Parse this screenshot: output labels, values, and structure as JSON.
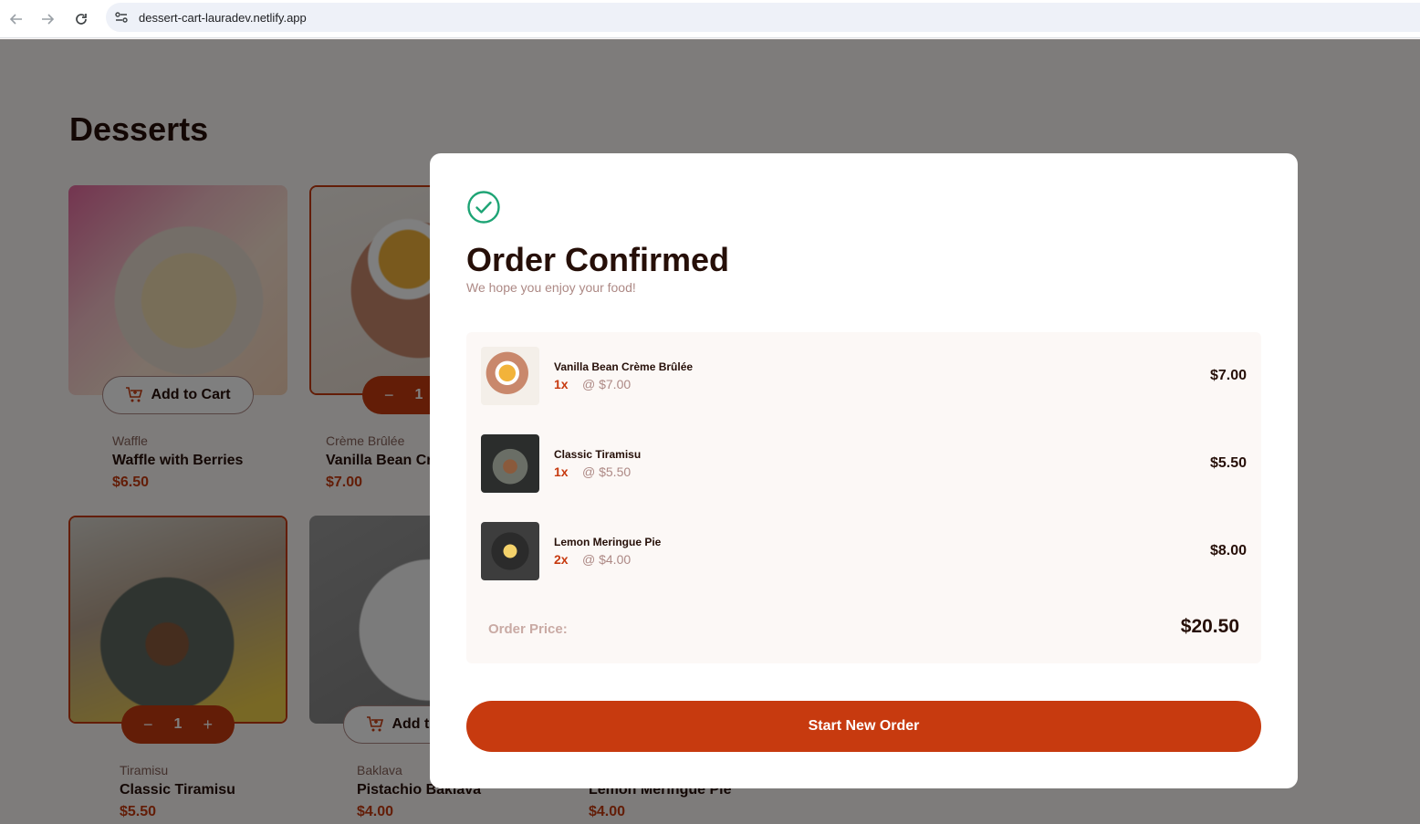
{
  "browser": {
    "url": "dessert-cart-lauradev.netlify.app"
  },
  "page": {
    "title": "Desserts"
  },
  "products": [
    {
      "category": "Waffle",
      "name": "Waffle with Berries",
      "price": "$6.50",
      "button": "Add to Cart"
    },
    {
      "category": "Crème Brûlée",
      "name": "Vanilla Bean Crème Brûlée",
      "price": "$7.00",
      "quantity": "1"
    },
    {
      "category": "Tiramisu",
      "name": "Classic Tiramisu",
      "price": "$5.50",
      "quantity": "1"
    },
    {
      "category": "Baklava",
      "name": "Pistachio Baklava",
      "price": "$4.00",
      "button": "Add to Cart"
    },
    {
      "name": "Lemon Meringue Pie",
      "price": "$4.00"
    }
  ],
  "modal": {
    "title": "Order Confirmed",
    "subtitle": "We hope you enjoy your food!",
    "items": [
      {
        "name": "Vanilla Bean Crème Brûlée",
        "qty": "1x",
        "unit": "@ $7.00",
        "total": "$7.00"
      },
      {
        "name": "Classic Tiramisu",
        "qty": "1x",
        "unit": "@ $5.50",
        "total": "$5.50"
      },
      {
        "name": "Lemon Meringue Pie",
        "qty": "2x",
        "unit": "@ $4.00",
        "total": "$8.00"
      }
    ],
    "order_label": "Order Price:",
    "order_total": "$20.50",
    "button_label": "Start New Order"
  },
  "colors": {
    "accent": "#c73a0f",
    "success": "#1ea475",
    "text": "#260f08"
  }
}
